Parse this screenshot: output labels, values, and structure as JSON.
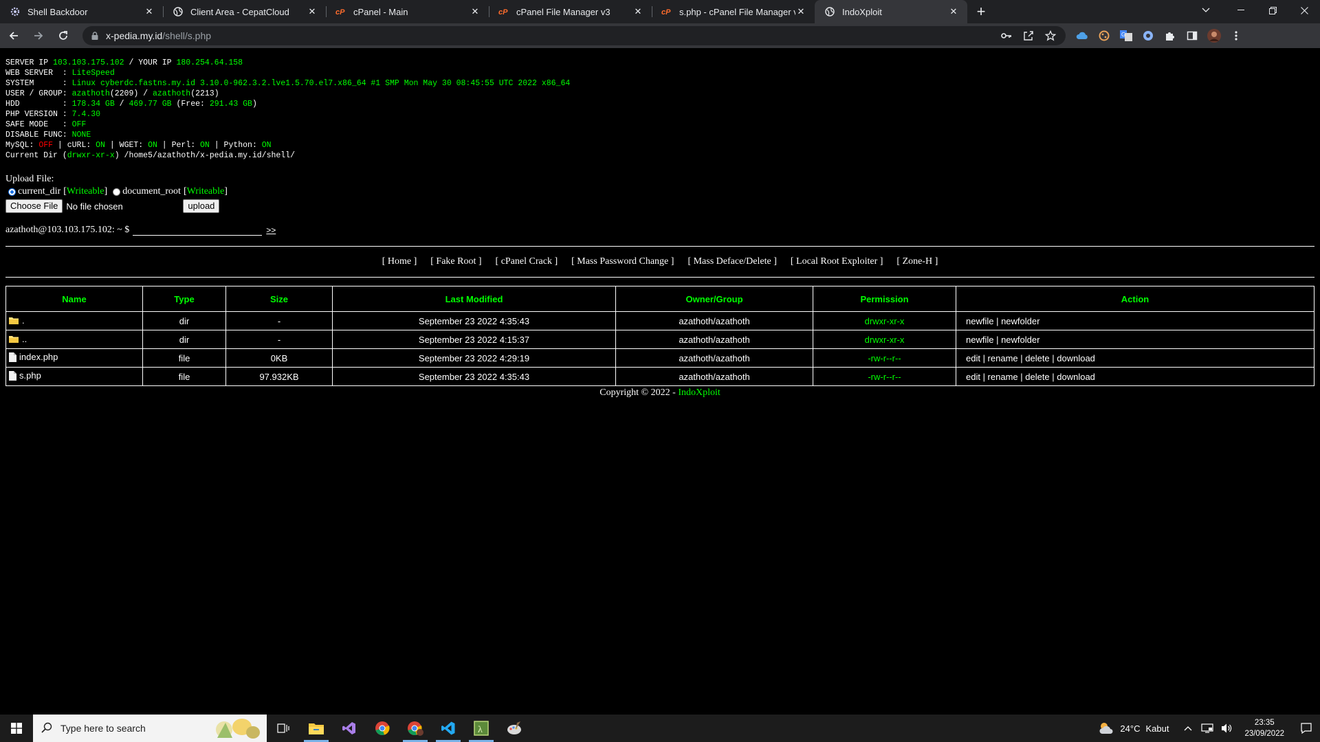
{
  "browser": {
    "tabs": [
      {
        "title": "Shell Backdoor",
        "favicon": "gear-icon"
      },
      {
        "title": "Client Area - CepatCloud",
        "favicon": "globe-icon"
      },
      {
        "title": "cPanel - Main",
        "favicon": "cpanel-icon"
      },
      {
        "title": "cPanel File Manager v3",
        "favicon": "cpanel-icon"
      },
      {
        "title": "s.php - cPanel File Manager v3",
        "favicon": "cpanel-icon"
      },
      {
        "title": "IndoXploit",
        "favicon": "globe-icon",
        "active": true
      }
    ],
    "url_host": "x-pedia.my.id",
    "url_path": "/shell/s.php"
  },
  "sysinfo": {
    "server_ip_label": "SERVER IP ",
    "server_ip": "103.103.175.102",
    "your_ip_label": " / YOUR IP ",
    "your_ip": "180.254.64.158",
    "web_server_label": "WEB SERVER  : ",
    "web_server": "LiteSpeed",
    "system_label": "SYSTEM      : ",
    "system": "Linux cyberdc.fastns.my.id 3.10.0-962.3.2.lve1.5.70.el7.x86_64 #1 SMP Mon May 30 08:45:55 UTC 2022 x86_64",
    "user_group_label": "USER / GROUP: ",
    "user": "azathoth",
    "uid": "(2209)",
    "sep": " / ",
    "group": "azathoth",
    "gid": "(2213)",
    "hdd_label": "HDD         : ",
    "hdd_used": "178.34 GB",
    "hdd_total": "469.77 GB",
    "hdd_free_open": " (Free: ",
    "hdd_free": "291.43 GB",
    "hdd_free_close": ")",
    "php_label": "PHP VERSION : ",
    "php": "7.4.30",
    "safe_label": "SAFE MODE   : ",
    "safe": "OFF",
    "disable_label": "DISABLE FUNC: ",
    "disable": "NONE",
    "mysql_label": "MySQL: ",
    "mysql": "OFF",
    "curl_label": " | cURL: ",
    "curl": "ON",
    "wget_label": " | WGET: ",
    "wget": "ON",
    "perl_label": " | Perl: ",
    "perl": "ON",
    "python_label": " | Python: ",
    "python": "ON",
    "curdir_label": "Current Dir (",
    "curdir_perm": "drwxr-xr-x",
    "curdir_path": ") /home5/azathoth/x-pedia.my.id/shell/"
  },
  "upload": {
    "label": "Upload File:",
    "opt1": "current_dir",
    "opt2": "document_root",
    "writeable": "Writeable",
    "choose": "Choose File",
    "nofile": "No file chosen",
    "submit": "upload"
  },
  "cmd": {
    "prompt": "azathoth@103.103.175.102: ~ $",
    "go": ">>"
  },
  "menu": [
    "[ Home ]",
    "[ Fake Root ]",
    "[ cPanel Crack ]",
    "[ Mass Password Change ]",
    "[ Mass Deface/Delete ]",
    "[ Local Root Exploiter ]",
    "[ Zone-H ]"
  ],
  "table": {
    "headers": [
      "Name",
      "Type",
      "Size",
      "Last Modified",
      "Owner/Group",
      "Permission",
      "Action"
    ],
    "rows": [
      {
        "name": ".",
        "icon": "folder-icon",
        "type": "dir",
        "size": "-",
        "modified": "September 23 2022 4:35:43",
        "owner": "azathoth/azathoth",
        "perm": "drwxr-xr-x",
        "action": "newfile | newfolder"
      },
      {
        "name": "..",
        "icon": "folder-icon",
        "type": "dir",
        "size": "-",
        "modified": "September 23 2022 4:15:37",
        "owner": "azathoth/azathoth",
        "perm": "drwxr-xr-x",
        "action": "newfile | newfolder"
      },
      {
        "name": "index.php",
        "icon": "file-icon",
        "type": "file",
        "size": "0KB",
        "modified": "September 23 2022 4:29:19",
        "owner": "azathoth/azathoth",
        "perm": "-rw-r--r--",
        "action": "edit | rename | delete | download"
      },
      {
        "name": "s.php",
        "icon": "file-icon",
        "type": "file",
        "size": "97.932KB",
        "modified": "September 23 2022 4:35:43",
        "owner": "azathoth/azathoth",
        "perm": "-rw-r--r--",
        "action": "edit | rename | delete | download"
      }
    ]
  },
  "footer": {
    "copyright": "Copyright © 2022 - ",
    "brand": "IndoXploit"
  },
  "taskbar": {
    "search_placeholder": "Type here to search",
    "temp": "24°C",
    "weather": "Kabut",
    "time": "23:35",
    "date": "23/09/2022"
  },
  "colors": {
    "accent_green": "#00ff00",
    "off_red": "#ff0000",
    "background": "#000000"
  }
}
